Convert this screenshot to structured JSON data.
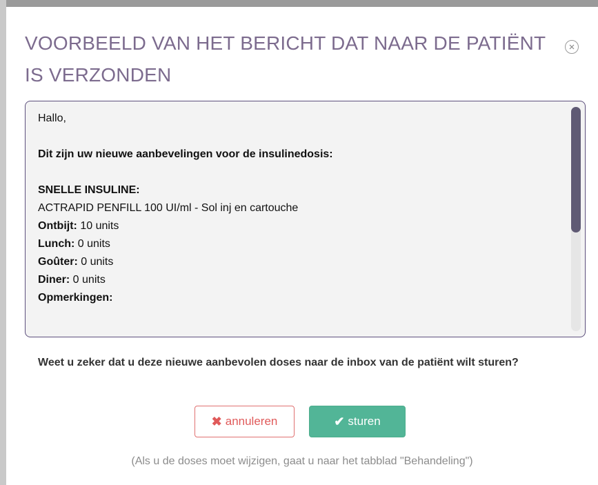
{
  "modal": {
    "title": "VOORBEELD VAN HET BERICHT DAT NAAR DE PATIËNT IS VERZONDEN",
    "close_icon": "close-circle-icon"
  },
  "message": {
    "greeting": "Hallo,",
    "intro": "Dit zijn uw nieuwe aanbevelingen voor de insulinedosis:",
    "section_heading": "SNELLE INSULINE:",
    "medication": "ACTRAPID PENFILL 100 UI/ml - Sol inj en cartouche",
    "doses": [
      {
        "label": "Ontbijt:",
        "value": " 10 units"
      },
      {
        "label": "Lunch:",
        "value": " 0 units"
      },
      {
        "label": "Goûter:",
        "value": " 0 units"
      },
      {
        "label": "Diner:",
        "value": " 0 units"
      }
    ],
    "remarks_label": "Opmerkingen:"
  },
  "confirm": {
    "question": "Weet u zeker dat u deze nieuwe aanbevolen doses naar de inbox van de patiënt wilt sturen?"
  },
  "buttons": {
    "cancel_label": "annuleren",
    "cancel_icon": "x-icon",
    "send_label": "sturen",
    "send_icon": "checkmark-icon"
  },
  "hint": "(Als u de doses moet wijzigen, gaat u naar het tabblad \"Behandeling\")",
  "colors": {
    "title": "#7c6b8e",
    "box_border": "#5c4f7c",
    "scroll_thumb": "#5f5a74",
    "cancel": "#e05a5a",
    "send": "#52b597"
  }
}
